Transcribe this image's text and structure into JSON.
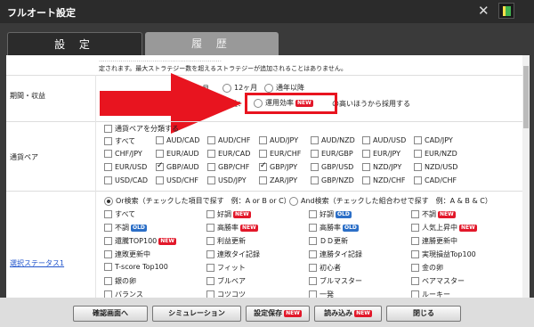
{
  "window": {
    "title": "フルオート設定",
    "close_glyph": "✕"
  },
  "tabs": [
    {
      "label": "設 定"
    },
    {
      "label": "履 歴"
    }
  ],
  "notice": {
    "line1": "..............................................................",
    "line2": "定されます。最大ストラテジー数を超えるストラテジーが追加されることはありません。"
  },
  "period": {
    "label": "期間・収益",
    "options": [
      "月",
      "12ヶ月",
      "通年以降"
    ],
    "operation_label": "取引利益：",
    "efficiency_option": "運用効率",
    "efficiency_badge": "NEW",
    "efficiency_suffix": "の高いほうから採用する"
  },
  "pairs": {
    "label": "通貨ペア",
    "group_by_label": "通貨ペアを分類する",
    "items": [
      {
        "label": "すべて",
        "checked": false
      },
      {
        "label": "AUD/CAD",
        "checked": false
      },
      {
        "label": "AUD/CHF",
        "checked": false
      },
      {
        "label": "AUD/JPY",
        "checked": false
      },
      {
        "label": "AUD/NZD",
        "checked": false
      },
      {
        "label": "AUD/USD",
        "checked": false
      },
      {
        "label": "CAD/JPY",
        "checked": false
      },
      {
        "label": "CHF/JPY",
        "checked": false
      },
      {
        "label": "EUR/AUD",
        "checked": false
      },
      {
        "label": "EUR/CAD",
        "checked": false
      },
      {
        "label": "EUR/CHF",
        "checked": false
      },
      {
        "label": "EUR/GBP",
        "checked": false
      },
      {
        "label": "EUR/JPY",
        "checked": false
      },
      {
        "label": "EUR/NZD",
        "checked": false
      },
      {
        "label": "EUR/USD",
        "checked": false
      },
      {
        "label": "GBP/AUD",
        "checked": true
      },
      {
        "label": "GBP/CHF",
        "checked": false
      },
      {
        "label": "GBP/JPY",
        "checked": true
      },
      {
        "label": "GBP/USD",
        "checked": false
      },
      {
        "label": "NZD/JPY",
        "checked": false
      },
      {
        "label": "NZD/USD",
        "checked": false
      },
      {
        "label": "USD/CAD",
        "checked": false
      },
      {
        "label": "USD/CHF",
        "checked": false
      },
      {
        "label": "USD/JPY",
        "checked": false
      },
      {
        "label": "ZAR/JPY",
        "checked": false
      },
      {
        "label": "GBP/NZD",
        "checked": false
      },
      {
        "label": "NZD/CHF",
        "checked": false
      },
      {
        "label": "CAD/CHF",
        "checked": false
      }
    ]
  },
  "status": {
    "label": "選択ステータス1",
    "or_search": "Or検索（チェックした項目で探す　例：A or B or C）",
    "and_search": "And検索（チェックした組合わせで探す　例：A & B & C）",
    "items": [
      {
        "label": "すべて",
        "badge": ""
      },
      {
        "label": "好調",
        "badge": "NEW"
      },
      {
        "label": "好調",
        "badge": "OLD"
      },
      {
        "label": "不調",
        "badge": "NEW"
      },
      {
        "label": "不調",
        "badge": "OLD"
      },
      {
        "label": "高勝率",
        "badge": "NEW"
      },
      {
        "label": "高勝率",
        "badge": "OLD"
      },
      {
        "label": "人気上昇中",
        "badge": "NEW"
      },
      {
        "label": "還騰TOP100",
        "badge": "NEW"
      },
      {
        "label": "利益更新",
        "badge": ""
      },
      {
        "label": "ＤＤ更新",
        "badge": ""
      },
      {
        "label": "連勝更新中",
        "badge": ""
      },
      {
        "label": "連敗更新中",
        "badge": ""
      },
      {
        "label": "連敗タイ記録",
        "badge": ""
      },
      {
        "label": "連勝タイ記録",
        "badge": ""
      },
      {
        "label": "実現損益Top100",
        "badge": ""
      },
      {
        "label": "T-score Top100",
        "badge": ""
      },
      {
        "label": "フィット",
        "badge": ""
      },
      {
        "label": "初心者",
        "badge": ""
      },
      {
        "label": "金の卵",
        "badge": ""
      },
      {
        "label": "銀の卵",
        "badge": ""
      },
      {
        "label": "ブルベア",
        "badge": ""
      },
      {
        "label": "ブルマスター",
        "badge": ""
      },
      {
        "label": "ベアマスター",
        "badge": ""
      },
      {
        "label": "バランス",
        "badge": ""
      },
      {
        "label": "コツコツ",
        "badge": ""
      },
      {
        "label": "一発",
        "badge": ""
      },
      {
        "label": "ルーキー",
        "badge": ""
      }
    ]
  },
  "footer": {
    "confirm": "確認画面へ",
    "simulation": "シミュレーション",
    "save": "設定保存",
    "load": "読み込み",
    "close": "閉じる",
    "new_badge": "NEW"
  },
  "colors": {
    "highlight": "#e8141f",
    "new_badge": "#e2182a",
    "old_badge": "#2c6fc7"
  }
}
